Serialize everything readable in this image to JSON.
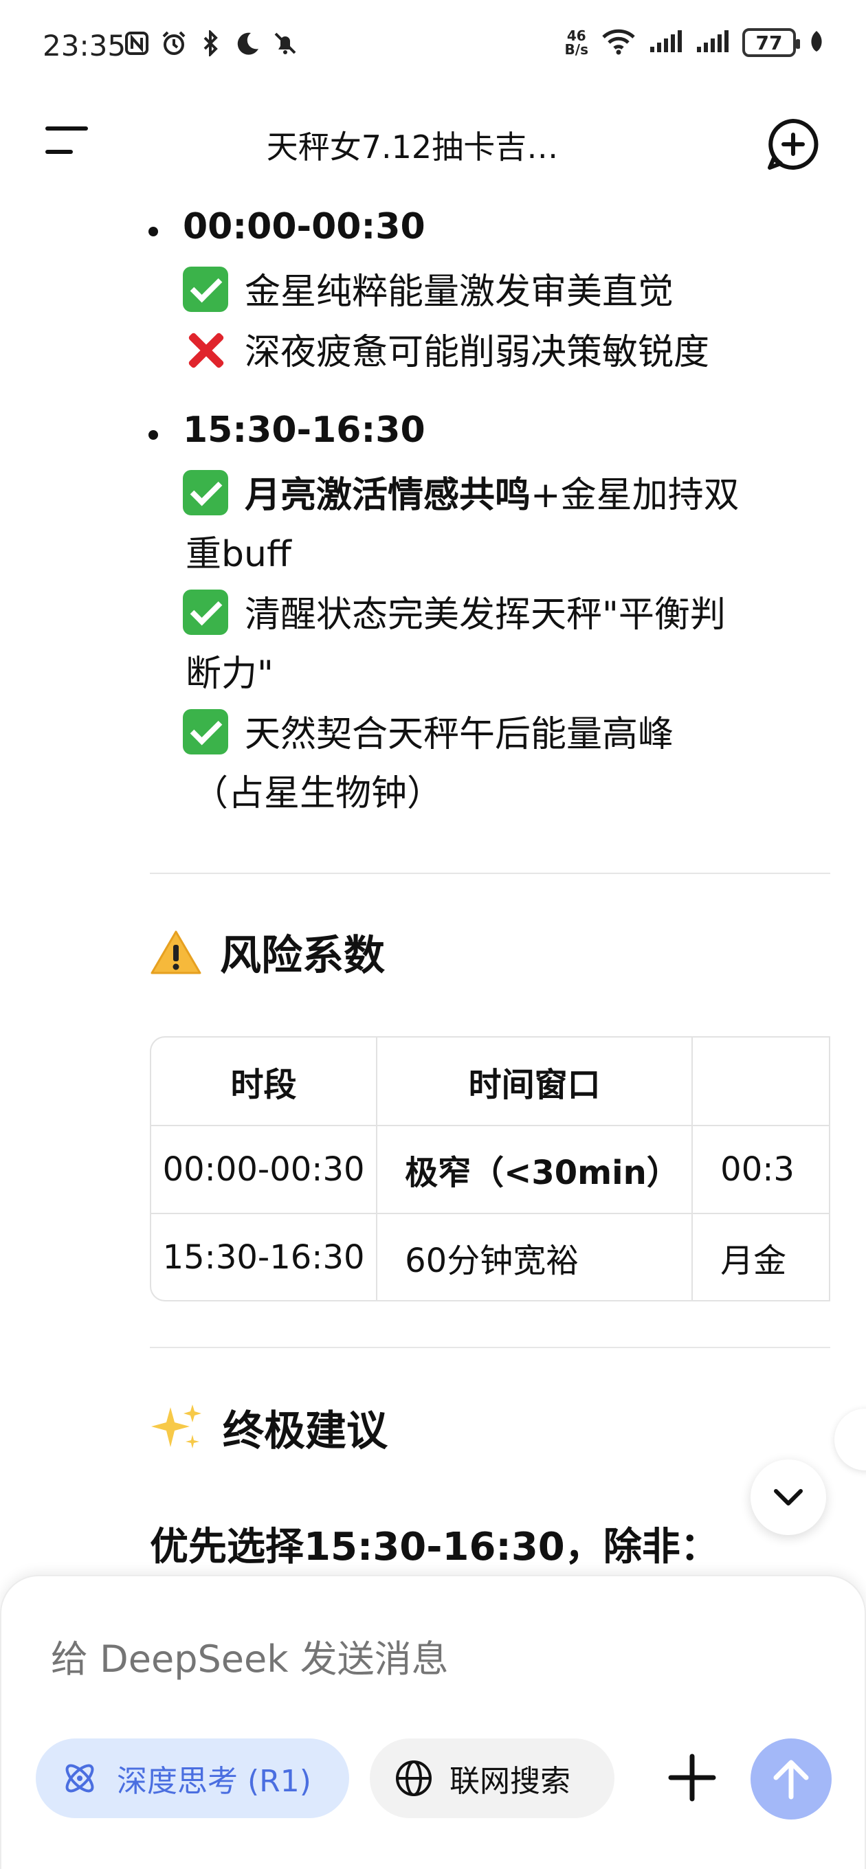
{
  "status_bar": {
    "time": "23:35",
    "net_speed_value": "46",
    "net_speed_unit": "B/s",
    "battery": "77"
  },
  "header": {
    "title": "天秤女7.12抽卡吉…"
  },
  "message": {
    "slot1": {
      "time": "00:00-00:30",
      "pro": "金星纯粹能量激发审美直觉",
      "con": "深夜疲惫可能削弱决策敏锐度"
    },
    "slot2": {
      "time": "15:30-16:30",
      "item1_bold": "月亮激活情感共鸣",
      "item1_rest": "+金星加持双",
      "item1_cont": "重buff",
      "item2_line1": "清醒状态完美发挥天秤\"平衡判",
      "item2_line2": "断力\"",
      "item3_line1": "天然契合天秤午后能量高峰",
      "item3_line2": "（占星生物钟）"
    },
    "risk_title": "风险系数",
    "table": {
      "headers": [
        "时段",
        "时间窗口",
        ""
      ],
      "rows": [
        [
          "00:00-00:30",
          "极窄（<30min）",
          "00:3"
        ],
        [
          "15:30-16:30",
          "60分钟宽裕",
          "月金"
        ]
      ]
    },
    "final_title": "终极建议",
    "final_line": "优先选择15:30-16:30，除非："
  },
  "composer": {
    "placeholder": "给 DeepSeek 发送消息",
    "deep_think_label": "深度思考 (R1)",
    "web_search_label": "联网搜索"
  },
  "colors": {
    "accent_blue": "#4a6ee0",
    "send_button": "#a3b8f8",
    "check_green": "#3bb34a",
    "cross_red": "#e0242c"
  }
}
